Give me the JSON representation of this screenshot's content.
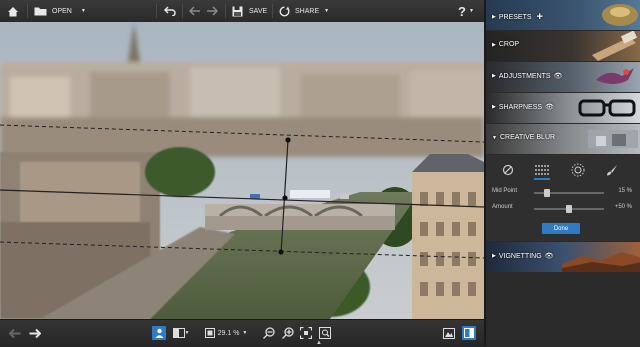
{
  "toolbar": {
    "open_label": "OPEN",
    "save_label": "SAVE",
    "share_label": "SHARE",
    "help_label": "?"
  },
  "statusbar": {
    "zoom_value": "29.1 %"
  },
  "panel": {
    "presets_label": "PRESETS",
    "crop_label": "CROP",
    "adjustments_label": "ADJUSTMENTS",
    "sharpness_label": "SHARPNESS",
    "creative_blur_label": "CREATIVE BLUR",
    "vignetting_label": "VIGNETTING",
    "creative_blur": {
      "midpoint_label": "Mid Point",
      "midpoint_value": "15 %",
      "midpoint_level": 0.15,
      "amount_label": "Amount",
      "amount_value": "+50 %",
      "amount_level": 0.5,
      "done_label": "Done"
    }
  },
  "colors": {
    "accent": "#2f7cc4",
    "panel_bg": "#2a2a2a"
  }
}
